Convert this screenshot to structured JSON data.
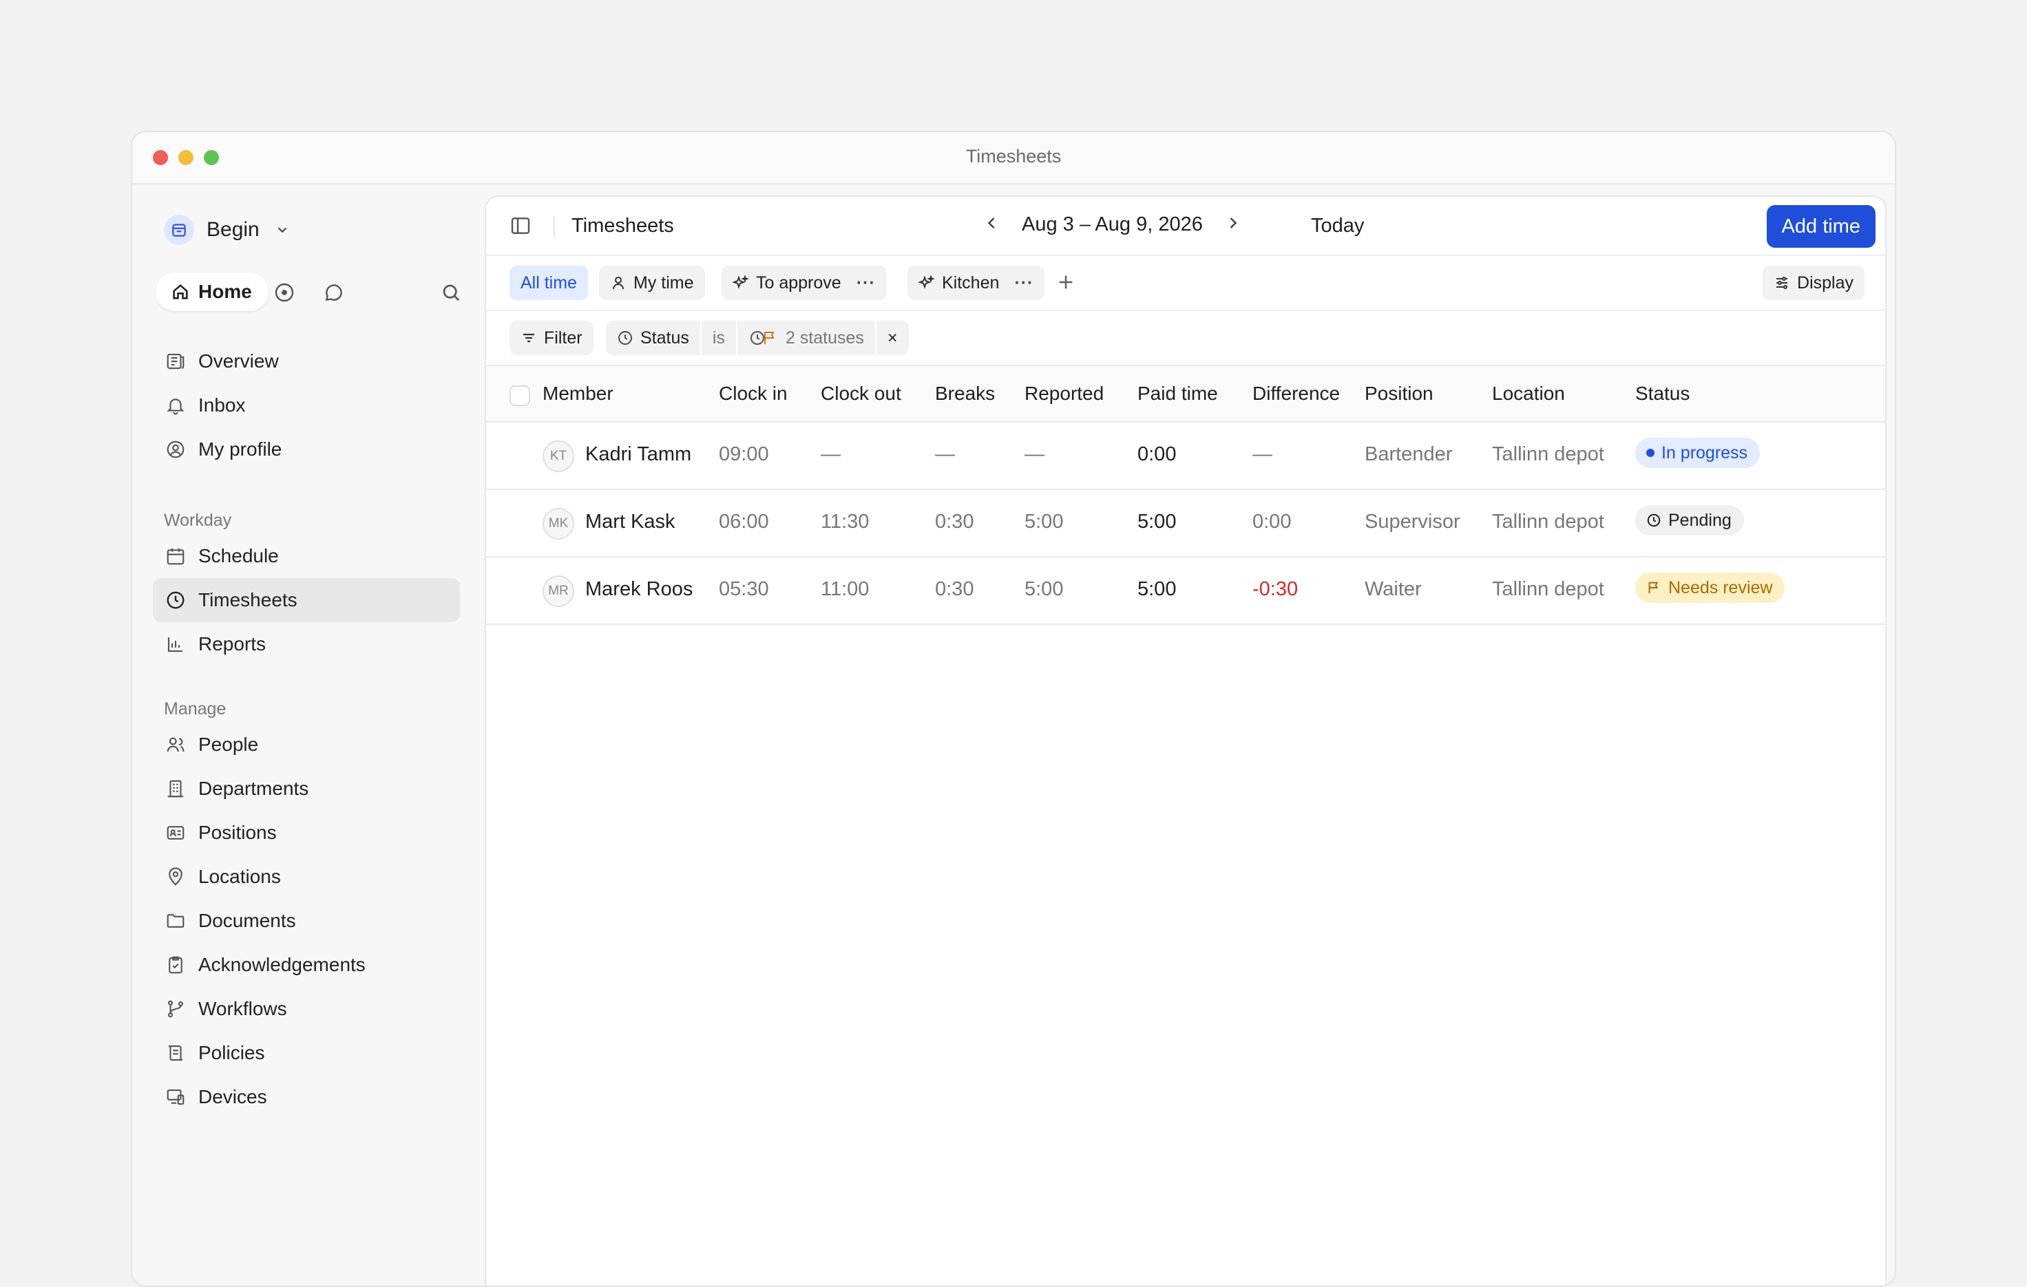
{
  "window": {
    "title": "Timesheets"
  },
  "sidebar": {
    "workspace": "Begin",
    "home_label": "Home",
    "top_items": [
      {
        "label": "Overview",
        "icon": "overview-icon"
      },
      {
        "label": "Inbox",
        "icon": "bell-icon"
      },
      {
        "label": "My profile",
        "icon": "profile-icon"
      }
    ],
    "section_workday": "Workday",
    "workday_items": [
      {
        "label": "Schedule",
        "icon": "calendar-icon"
      },
      {
        "label": "Timesheets",
        "icon": "clock-icon",
        "active": true
      },
      {
        "label": "Reports",
        "icon": "bar-chart-icon"
      }
    ],
    "section_manage": "Manage",
    "manage_items": [
      {
        "label": "People",
        "icon": "people-icon"
      },
      {
        "label": "Departments",
        "icon": "building-icon"
      },
      {
        "label": "Positions",
        "icon": "id-card-icon"
      },
      {
        "label": "Locations",
        "icon": "pin-icon"
      },
      {
        "label": "Documents",
        "icon": "folder-icon"
      },
      {
        "label": "Acknowledgements",
        "icon": "clipboard-check-icon"
      },
      {
        "label": "Workflows",
        "icon": "branch-icon"
      },
      {
        "label": "Policies",
        "icon": "scroll-icon"
      },
      {
        "label": "Devices",
        "icon": "devices-icon"
      }
    ]
  },
  "toolbar": {
    "title": "Timesheets",
    "date_range": "Aug 3 – Aug 9, 2026",
    "today": "Today",
    "add_time": "Add time"
  },
  "views": {
    "all_time": "All time",
    "my_time": "My time",
    "to_approve": "To approve",
    "kitchen": "Kitchen",
    "more": "···",
    "display": "Display"
  },
  "filters": {
    "filter_label": "Filter",
    "field": "Status",
    "operator": "is",
    "value": "2 statuses",
    "remove": "×"
  },
  "table": {
    "columns": {
      "member": "Member",
      "clock_in": "Clock in",
      "clock_out": "Clock out",
      "breaks": "Breaks",
      "reported": "Reported",
      "paid_time": "Paid time",
      "difference": "Difference",
      "position": "Position",
      "location": "Location",
      "status": "Status"
    },
    "rows": [
      {
        "initials": "KT",
        "name": "Kadri Tamm",
        "clock_in": "09:00",
        "clock_out": "—",
        "breaks": "—",
        "reported": "—",
        "paid_time": "0:00",
        "difference": "—",
        "position": "Bartender",
        "location": "Tallinn depot",
        "status": "In progress"
      },
      {
        "initials": "MK",
        "name": "Mart Kask",
        "clock_in": "06:00",
        "clock_out": "11:30",
        "breaks": "0:30",
        "reported": "5:00",
        "paid_time": "5:00",
        "difference": "0:00",
        "position": "Supervisor",
        "location": "Tallinn depot",
        "status": "Pending"
      },
      {
        "initials": "MR",
        "name": "Marek Roos",
        "clock_in": "05:30",
        "clock_out": "11:00",
        "breaks": "0:30",
        "reported": "5:00",
        "paid_time": "5:00",
        "difference": "-0:30",
        "position": "Waiter",
        "location": "Tallinn depot",
        "status": "Needs review"
      }
    ]
  },
  "colors": {
    "accent": "#1f4fd8",
    "negative": "#d12b2b",
    "review_bg": "#fdf0c5",
    "review_text": "#a86c00",
    "progress_bg": "#e2ebff"
  }
}
